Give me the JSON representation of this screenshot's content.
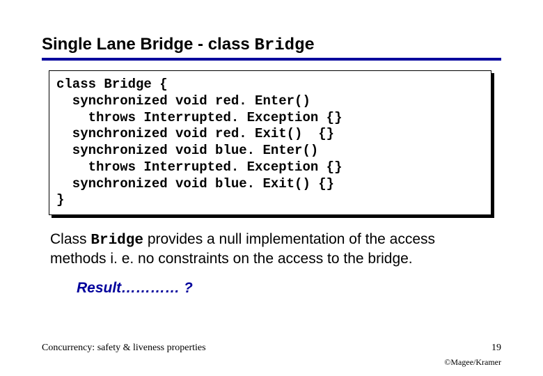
{
  "title_plain": "Single Lane Bridge - class ",
  "title_mono": "Bridge",
  "code": "class Bridge {\n  synchronized void red. Enter()\n    throws Interrupted. Exception {}\n  synchronized void red. Exit()  {}\n  synchronized void blue. Enter()\n    throws Interrupted. Exception {}\n  synchronized void blue. Exit() {}\n}",
  "body_pre": "Class ",
  "body_mono": "Bridge",
  "body_post": " provides a null implementation of the access methods i. e. no constraints on the access to the bridge.",
  "result": "Result………… ?",
  "footer_left": "Concurrency: safety & liveness properties",
  "footer_page": "19",
  "copyright": "©Magee/Kramer"
}
